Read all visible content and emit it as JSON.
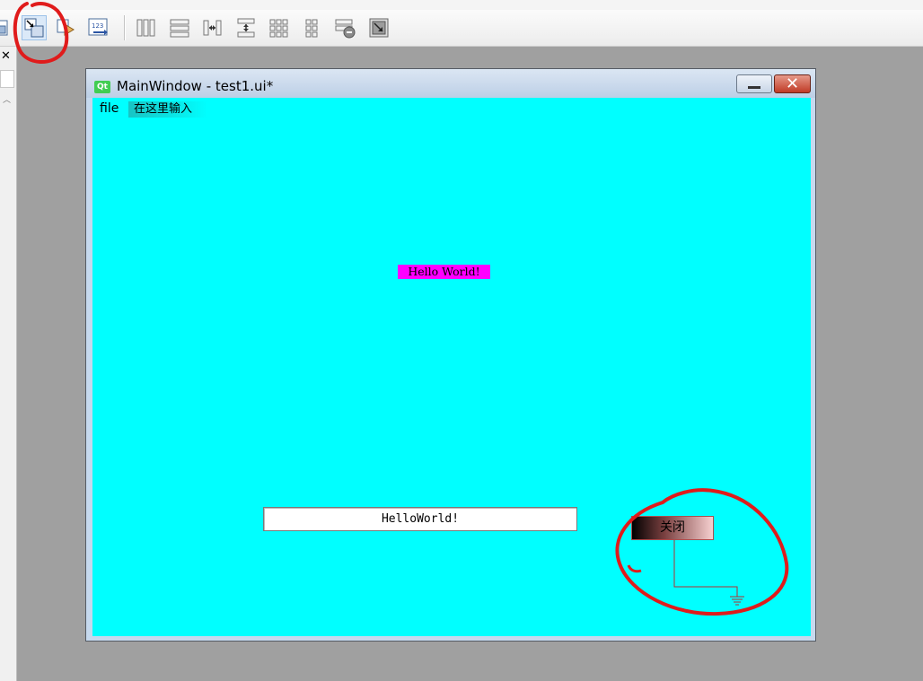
{
  "window": {
    "title": "MainWindow - test1.ui*",
    "icon_text": "Qt",
    "min_label": "",
    "close_label": "✕"
  },
  "menubar": {
    "file": "file",
    "type_here": "在这里输入"
  },
  "content": {
    "label_text": "Hello World!",
    "line_edit_text": "HelloWorld!",
    "button_text": "关闭"
  },
  "leftdock": {
    "close_glyph": "✕"
  },
  "toolbar": {
    "icons": [
      "edit-widgets-icon",
      "edit-signals-slots-icon",
      "edit-buddies-icon",
      "edit-tab-order-icon",
      "layout-horizontal-icon",
      "layout-vertical-icon",
      "layout-horizontal-splitter-icon",
      "layout-vertical-splitter-icon",
      "layout-grid-icon",
      "layout-form-icon",
      "break-layout-icon",
      "adjust-size-icon"
    ]
  },
  "colors": {
    "client_bg": "#00ffff",
    "label_bg": "#ff00ff",
    "annotation": "#e01b1b"
  }
}
